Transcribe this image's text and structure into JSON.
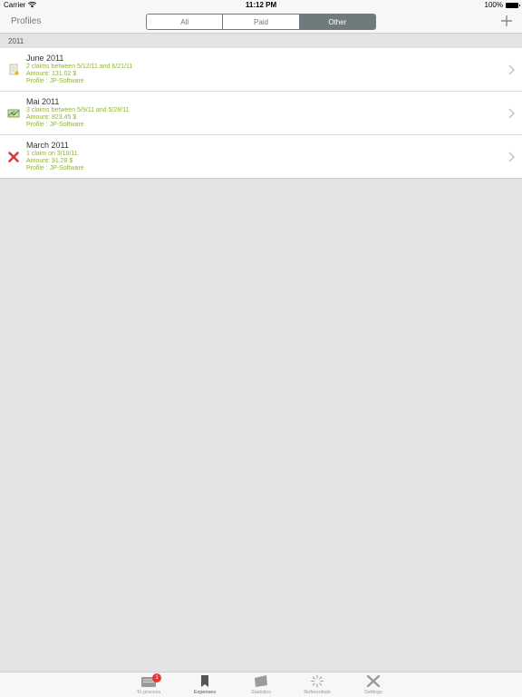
{
  "status_bar": {
    "carrier": "Carrier",
    "time": "11:12 PM",
    "battery": "100%"
  },
  "nav": {
    "title": "Profiles",
    "segments": [
      "All",
      "Paid",
      "Other"
    ],
    "selected_segment": "Other",
    "add_icon": "plus-icon"
  },
  "section": {
    "header": "2011"
  },
  "claims": [
    {
      "title": "June 2011",
      "summary": "2 claims between 5/12/11 and 6/21/11",
      "amount": "Amount: 131.02 $",
      "profile": "Profile : JP-Software",
      "icon": "pending-document-icon"
    },
    {
      "title": "Mai 2011",
      "summary": "3 claims between 5/9/11 and 5/28/11",
      "amount": "Amount: 823.45 $",
      "profile": "Profile : JP-Software",
      "icon": "paid-money-icon"
    },
    {
      "title": "March 2011",
      "summary": "1 claim on 3/18/11",
      "amount": "Amount: 91.28 $",
      "profile": "Profile : JP-Software",
      "icon": "rejected-x-icon"
    }
  ],
  "tabs": [
    {
      "label": "To process",
      "icon": "inbox-icon",
      "badge": "1"
    },
    {
      "label": "Expenses",
      "icon": "bookmark-icon",
      "active": true
    },
    {
      "label": "Statistics",
      "icon": "statistics-icon"
    },
    {
      "label": "Referentials",
      "icon": "spinner-icon"
    },
    {
      "label": "Settings",
      "icon": "tools-icon"
    }
  ],
  "colors": {
    "accent": "#6f7a7d",
    "detail_text": "#8fb43a",
    "badge": "#e53935",
    "background": "#e3e3e3"
  }
}
